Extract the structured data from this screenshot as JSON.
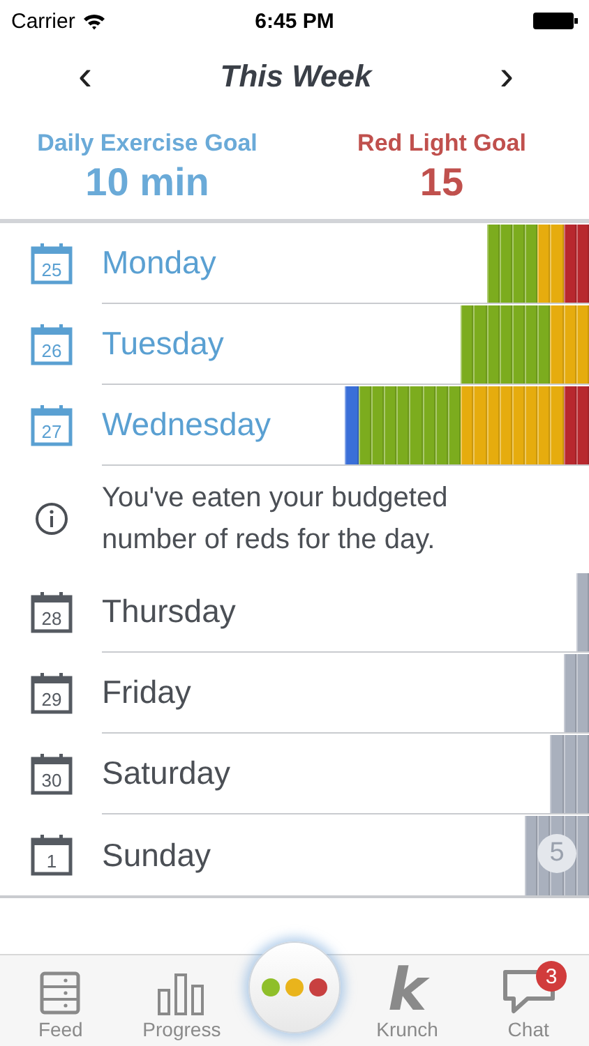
{
  "status_bar": {
    "carrier": "Carrier",
    "time": "6:45 PM"
  },
  "header": {
    "prev": "‹",
    "title": "This Week",
    "next": "›"
  },
  "goals": [
    {
      "label": "Daily Exercise Goal",
      "value": "10 min",
      "color": "#6aaad8"
    },
    {
      "label": "Red Light Goal",
      "value": "15",
      "color": "#c0504d"
    }
  ],
  "days": [
    {
      "kind": "day",
      "date": "25",
      "name": "Monday",
      "completed": true,
      "segments": [
        {
          "color": "#7cac1e"
        },
        {
          "color": "#7cac1e"
        },
        {
          "color": "#7cac1e"
        },
        {
          "color": "#7cac1e"
        },
        {
          "color": "#e6ac0e"
        },
        {
          "color": "#e6ac0e"
        },
        {
          "color": "#b8282e"
        },
        {
          "color": "#b8282e"
        }
      ]
    },
    {
      "kind": "day",
      "date": "26",
      "name": "Tuesday",
      "completed": true,
      "segments": [
        {
          "color": "#7cac1e"
        },
        {
          "color": "#7cac1e"
        },
        {
          "color": "#7cac1e"
        },
        {
          "color": "#7cac1e"
        },
        {
          "color": "#7cac1e"
        },
        {
          "color": "#7cac1e"
        },
        {
          "color": "#7cac1e"
        },
        {
          "color": "#e6ac0e"
        },
        {
          "color": "#e6ac0e"
        },
        {
          "color": "#e6ac0e"
        }
      ]
    },
    {
      "kind": "day",
      "date": "27",
      "name": "Wednesday",
      "completed": true,
      "segments": [
        {
          "color": "#3a6fd8"
        },
        {
          "color": "#7cac1e"
        },
        {
          "color": "#7cac1e"
        },
        {
          "color": "#7cac1e"
        },
        {
          "color": "#7cac1e"
        },
        {
          "color": "#7cac1e"
        },
        {
          "color": "#7cac1e"
        },
        {
          "color": "#7cac1e"
        },
        {
          "color": "#7cac1e"
        },
        {
          "color": "#e6ac0e"
        },
        {
          "color": "#e6ac0e"
        },
        {
          "color": "#e6ac0e"
        },
        {
          "color": "#e6ac0e"
        },
        {
          "color": "#e6ac0e"
        },
        {
          "color": "#e6ac0e"
        },
        {
          "color": "#e6ac0e"
        },
        {
          "color": "#e6ac0e"
        },
        {
          "color": "#b8282e"
        },
        {
          "color": "#b8282e"
        }
      ]
    },
    {
      "kind": "info",
      "text": "You've eaten your budgeted number of reds for the day."
    },
    {
      "kind": "day",
      "date": "28",
      "name": "Thursday",
      "completed": false,
      "segments": [
        {
          "color": "#a9b0bd"
        }
      ]
    },
    {
      "kind": "day",
      "date": "29",
      "name": "Friday",
      "completed": false,
      "segments": [
        {
          "color": "#a9b0bd"
        },
        {
          "color": "#a9b0bd"
        }
      ]
    },
    {
      "kind": "day",
      "date": "30",
      "name": "Saturday",
      "completed": false,
      "segments": [
        {
          "color": "#a9b0bd"
        },
        {
          "color": "#a9b0bd"
        },
        {
          "color": "#a9b0bd"
        }
      ]
    },
    {
      "kind": "day",
      "date": "1",
      "name": "Sunday",
      "completed": false,
      "segments": [
        {
          "color": "#a9b0bd"
        },
        {
          "color": "#a9b0bd"
        },
        {
          "color": "#a9b0bd"
        },
        {
          "color": "#a9b0bd"
        },
        {
          "color": "#a9b0bd"
        }
      ],
      "badge": "5"
    }
  ],
  "tabs": [
    {
      "kind": "feed",
      "label": "Feed"
    },
    {
      "kind": "progress",
      "label": "Progress"
    },
    {
      "kind": "lights"
    },
    {
      "kind": "logo",
      "icon_text": "k",
      "label": "Krunch"
    },
    {
      "kind": "chat",
      "label": "Chat",
      "badge": "3"
    }
  ]
}
